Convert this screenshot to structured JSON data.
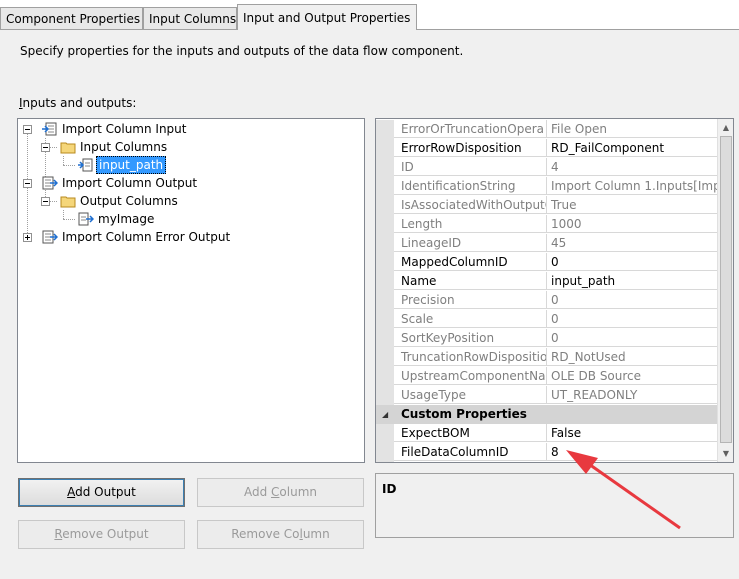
{
  "tabs": [
    {
      "label": "Component Properties"
    },
    {
      "label": "Input Columns"
    },
    {
      "label": "Input and Output Properties"
    }
  ],
  "description": "Specify properties for the inputs and outputs of the data flow component.",
  "io_label": {
    "hotkey": "I",
    "rest": "nputs and outputs:"
  },
  "tree": {
    "import_column_input": "Import Column Input",
    "input_columns": "Input Columns",
    "input_path": "input_path",
    "import_column_output": "Import Column Output",
    "output_columns": "Output Columns",
    "myimage": "myImage",
    "import_column_error_output": "Import Column Error Output"
  },
  "props": {
    "rows": [
      {
        "name": "ErrorOrTruncationOpera",
        "value": "File Open"
      },
      {
        "name": "ErrorRowDisposition",
        "value": "RD_FailComponent"
      },
      {
        "name": "ID",
        "value": "4"
      },
      {
        "name": "IdentificationString",
        "value": "Import Column 1.Inputs[Impo"
      },
      {
        "name": "IsAssociatedWithOutputC",
        "value": "True"
      },
      {
        "name": "Length",
        "value": "1000"
      },
      {
        "name": "LineageID",
        "value": "45"
      },
      {
        "name": "MappedColumnID",
        "value": "0"
      },
      {
        "name": "Name",
        "value": "input_path"
      },
      {
        "name": "Precision",
        "value": "0"
      },
      {
        "name": "Scale",
        "value": "0"
      },
      {
        "name": "SortKeyPosition",
        "value": "0"
      },
      {
        "name": "TruncationRowDispositio",
        "value": "RD_NotUsed"
      },
      {
        "name": "UpstreamComponentNar",
        "value": "OLE DB Source"
      },
      {
        "name": "UsageType",
        "value": "UT_READONLY"
      }
    ],
    "category": "Custom Properties",
    "custom_rows": [
      {
        "name": "ExpectBOM",
        "value": "False"
      },
      {
        "name": "FileDataColumnID",
        "value": "8"
      }
    ]
  },
  "description_panel": {
    "title": "ID"
  },
  "buttons": {
    "add_output": {
      "hotkey": "A",
      "rest": "dd Output"
    },
    "add_column": {
      "pre": "Add ",
      "hotkey": "C",
      "rest": "olumn"
    },
    "remove_output": {
      "hotkey": "R",
      "rest": "emove Output"
    },
    "remove_column": {
      "pre": "Remove Co",
      "hotkey": "l",
      "rest": "umn"
    }
  },
  "colors": {
    "selection": "#3399ff",
    "annotation_arrow": "#e8393f"
  }
}
